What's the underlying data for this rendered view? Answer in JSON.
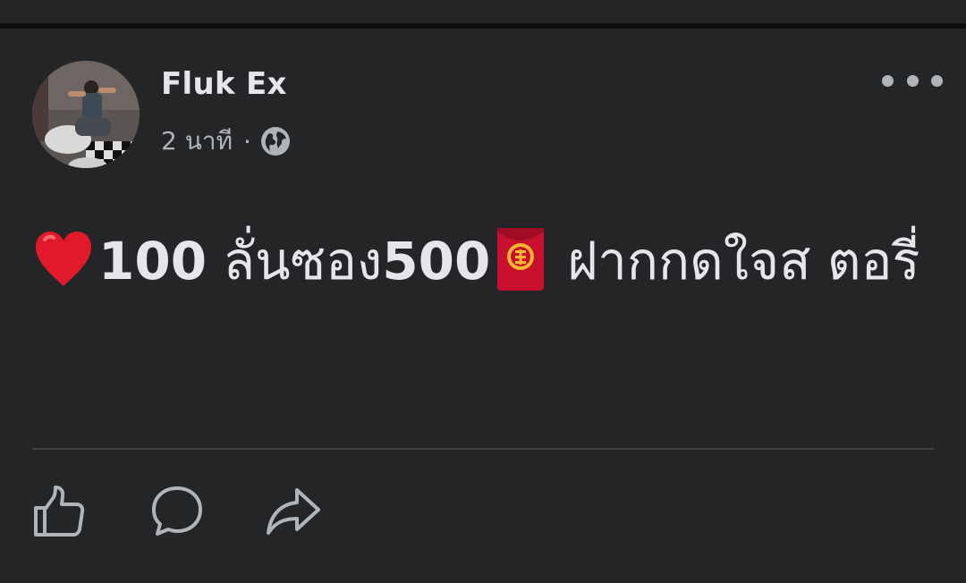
{
  "post": {
    "author_name": "Fluk Ex",
    "time_ago": "2 นาที",
    "separator": "·",
    "audience_icon": "globe-icon",
    "text_lead": "100",
    "text_mid": " ลั่นซอง",
    "text_number": "500",
    "text_tail": "ฝากกดใจส ตอรี่",
    "emojis": [
      "heart-icon",
      "red-envelope-icon"
    ],
    "more_icon": "more-horizontal-icon"
  },
  "actions": [
    {
      "name": "like",
      "icon": "thumbs-up-icon"
    },
    {
      "name": "comment",
      "icon": "comment-bubble-icon"
    },
    {
      "name": "share",
      "icon": "share-arrow-icon"
    }
  ],
  "colors": {
    "background": "#18191a",
    "card": "#242526",
    "primary_text": "#e4e6eb",
    "secondary_text": "#b0b3b8",
    "divider": "#3e4042",
    "heart": "#e0192b",
    "envelope": "#c8102e"
  }
}
